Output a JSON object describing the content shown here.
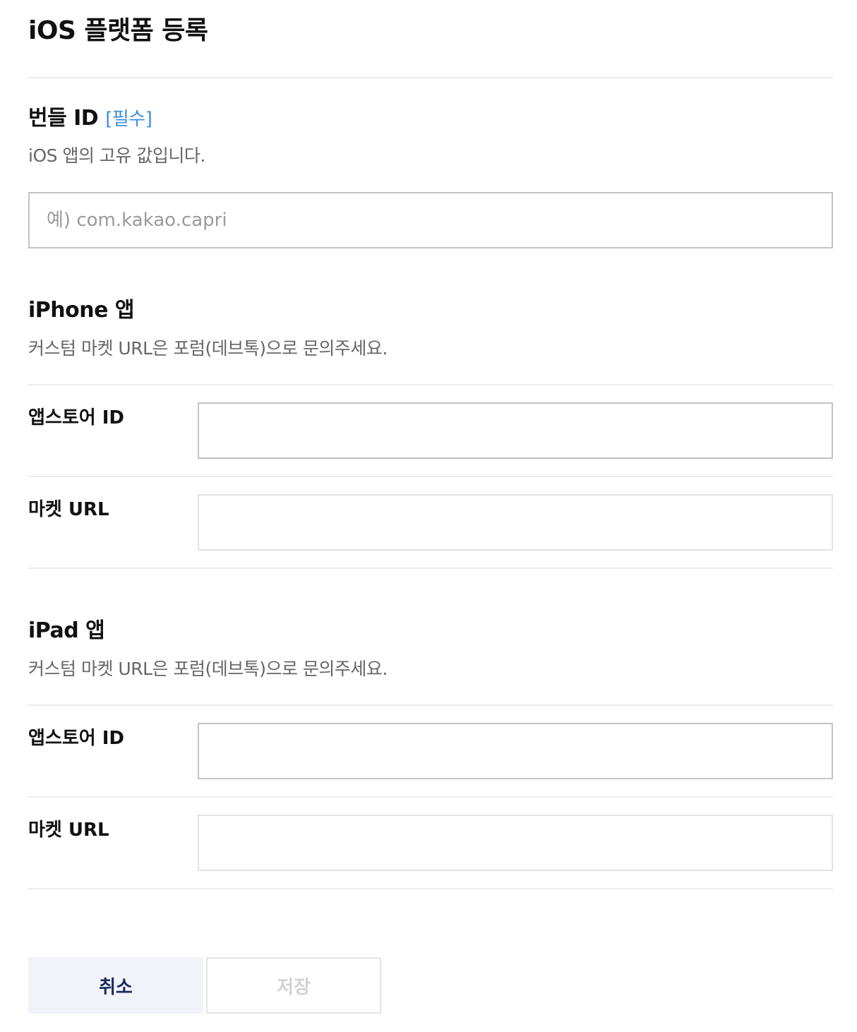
{
  "page": {
    "title": "iOS 플랫폼 등록"
  },
  "bundle": {
    "title": "번들 ID",
    "required": "[필수]",
    "desc": "iOS 앱의 고유 값입니다.",
    "placeholder": "예) com.kakao.capri",
    "value": ""
  },
  "iphone": {
    "title": "iPhone 앱",
    "desc": "커스텀 마켓 URL은 포럼(데브톡)으로 문의주세요.",
    "appstore_label": "앱스토어 ID",
    "appstore_value": "",
    "market_label": "마켓 URL",
    "market_value": ""
  },
  "ipad": {
    "title": "iPad 앱",
    "desc": "커스텀 마켓 URL은 포럼(데브톡)으로 문의주세요.",
    "appstore_label": "앱스토어 ID",
    "appstore_value": "",
    "market_label": "마켓 URL",
    "market_value": ""
  },
  "actions": {
    "cancel_label": "취소",
    "save_label": "저장"
  },
  "colors": {
    "required_accent": "#3d8ee0",
    "cancel_bg": "#f1f3f9",
    "cancel_text": "#1a2a5c",
    "save_disabled_text": "#d3d3d3",
    "desc_text": "#666666",
    "divider": "#ececec"
  }
}
